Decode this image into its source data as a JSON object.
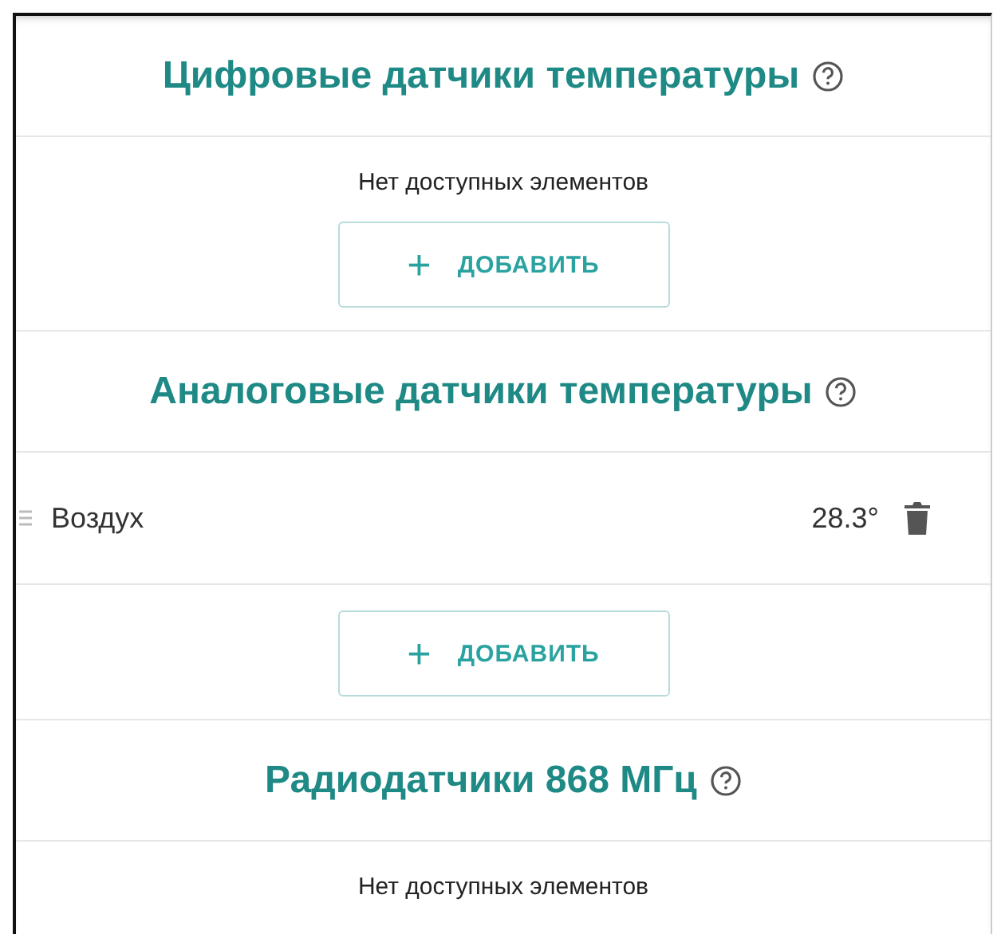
{
  "sections": [
    {
      "title": "Цифровые датчики температуры",
      "empty_text": "Нет доступных элементов",
      "add_button": {
        "icon": "+",
        "label": "ДОБАВИТЬ"
      }
    },
    {
      "title": "Аналоговые датчики температуры",
      "items": [
        {
          "name": "Воздух",
          "value": "28.3°"
        }
      ],
      "add_button": {
        "icon": "+",
        "label": "ДОБАВИТЬ"
      }
    },
    {
      "title": "Радиодатчики 868 МГц",
      "empty_text": "Нет доступных элементов"
    }
  ]
}
